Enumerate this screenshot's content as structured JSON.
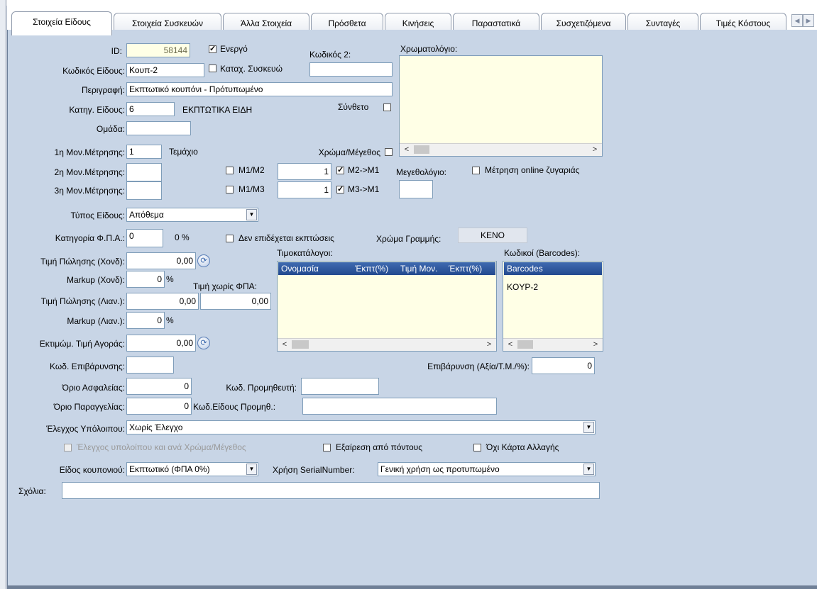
{
  "tabs": [
    "Στοιχεία Είδους",
    "Στοιχεία Συσκευών",
    "Άλλα Στοιχεία",
    "Πρόσθετα",
    "Κινήσεις",
    "Παραστατικά",
    "Συσχετιζόμενα",
    "Συνταγές",
    "Τιμές Κόστους"
  ],
  "form": {
    "id_label": "ID:",
    "id_value": "58144",
    "active_label": "Ενεργό",
    "code2_label": "Κωδικός 2:",
    "code2_value": "",
    "color_list_label": "Χρωματολόγιο:",
    "item_code_label": "Κωδικός Είδους:",
    "item_code_value": "Κουπ-2",
    "device_reg_label": "Καταχ. Συσκευώ",
    "description_label": "Περιγραφή:",
    "description_value": "Εκπτωτικό κουπόνι - Πρότυπωμένο",
    "category_label": "Κατηγ. Είδους:",
    "category_value": "6",
    "category_name": "ΕΚΠΤΩΤΙΚΑ ΕΙΔΗ",
    "composite_label": "Σύνθετο",
    "group_label": "Ομάδα:",
    "group_value": "",
    "uom1_label": "1η Μον.Μέτρησης:",
    "uom1_value": "1",
    "uom1_name": "Τεμάχιο",
    "color_size_label": "Χρώμα/Μέγεθος",
    "uom2_label": "2η Μον.Μέτρησης:",
    "uom2_value": "",
    "m1m2_label": "M1/M2",
    "m1m2_value": "1",
    "m2m1_label": "M2->M1",
    "size_list_label": "Μεγεθολόγιο:",
    "online_scale_label": "Μέτρηση online ζυγαριάς",
    "uom3_label": "3η Μον.Μέτρησης:",
    "uom3_value": "",
    "m1m3_label": "M1/M3",
    "m1m3_value": "1",
    "m3m1_label": "M3->M1",
    "size_value": "",
    "item_type_label": "Τύπος Είδους:",
    "item_type_value": "Απόθεμα",
    "vat_cat_label": "Κατηγορία Φ.Π.Α.:",
    "vat_cat_value": "0",
    "vat_pct": "0 %",
    "no_discounts_label": "Δεν επιδέχεται εκπτώσεις",
    "line_color_label": "Χρώμα Γραμμής:",
    "line_color_value": "ΚΕΝΟ",
    "wholesale_price_label": "Τιμή Πώλησης (Χονδ):",
    "wholesale_price_value": "0,00",
    "markup_wh_label": "Markup (Χονδ):",
    "markup_wh_value": "0",
    "pct": "%",
    "retail_price_label": "Τιμή Πώλησης (Λιαν.):",
    "retail_price_value": "0,00",
    "price_novat_label": "Τιμή χωρίς ΦΠΑ:",
    "price_novat_value": "0,00",
    "markup_rt_label": "Markup (Λιαν.):",
    "markup_rt_value": "0",
    "est_purchase_label": "Εκτιμώμ. Τιμή Αγοράς:",
    "est_purchase_value": "0,00",
    "surcharge_code_label": "Κωδ. Επιβάρυνσης:",
    "surcharge_code_value": "",
    "surcharge_label": "Επιβάρυνση (Αξία/Τ.Μ./%):",
    "surcharge_value": "0",
    "safety_limit_label": "Όριο Ασφαλείας:",
    "safety_limit_value": "0",
    "supplier_code_label": "Κωδ. Προμηθευτή:",
    "supplier_code_value": "",
    "order_limit_label": "Όριο Παραγγελίας:",
    "order_limit_value": "0",
    "supplier_item_label": "Κωδ.Είδους Προμηθ.:",
    "supplier_item_value": "",
    "balance_check_label": "Έλεγχος Υπόλοιπου:",
    "balance_check_value": "Χωρίς Έλεγχο",
    "balance_cs_label": "Έλεγχος υπολοίπου και ανά Χρώμα/Μέγεθος",
    "exclude_points_label": "Εξαίρεση από πόντους",
    "no_change_card_label": "Όχι Κάρτα Αλλαγής",
    "coupon_type_label": "Είδος κουπονιού:",
    "coupon_type_value": "Εκπτωτικό (ΦΠΑ 0%)",
    "serial_label": "Χρήση SerialNumber:",
    "serial_value": "Γενική χρήση ως προτυπωμένο",
    "comments_label": "Σχόλια:",
    "comments_value": ""
  },
  "price_lists": {
    "label": "Τιμοκατάλογοι:",
    "columns": [
      "Ονομασία",
      "Έκπτ(%)",
      "Τιμή Μον.",
      "Έκπτ(%)"
    ]
  },
  "barcodes": {
    "label": "Κωδικοί (Barcodes):",
    "header": "Barcodes",
    "rows": [
      "KOYP-2"
    ]
  },
  "checks": {
    "active": true,
    "device_reg": false,
    "composite": false,
    "color_size": false,
    "m1m2": false,
    "m2m1": true,
    "online_scale": false,
    "m1m3": false,
    "m3m1": true,
    "no_discounts": false,
    "balance_cs": false,
    "exclude_points": false,
    "no_change_card": false
  },
  "icons": {
    "dropdown": "chevron-down-icon",
    "refresh": "refresh-icon",
    "scroll_left": "scroll-left-icon",
    "scroll_right": "scroll-right-icon"
  }
}
